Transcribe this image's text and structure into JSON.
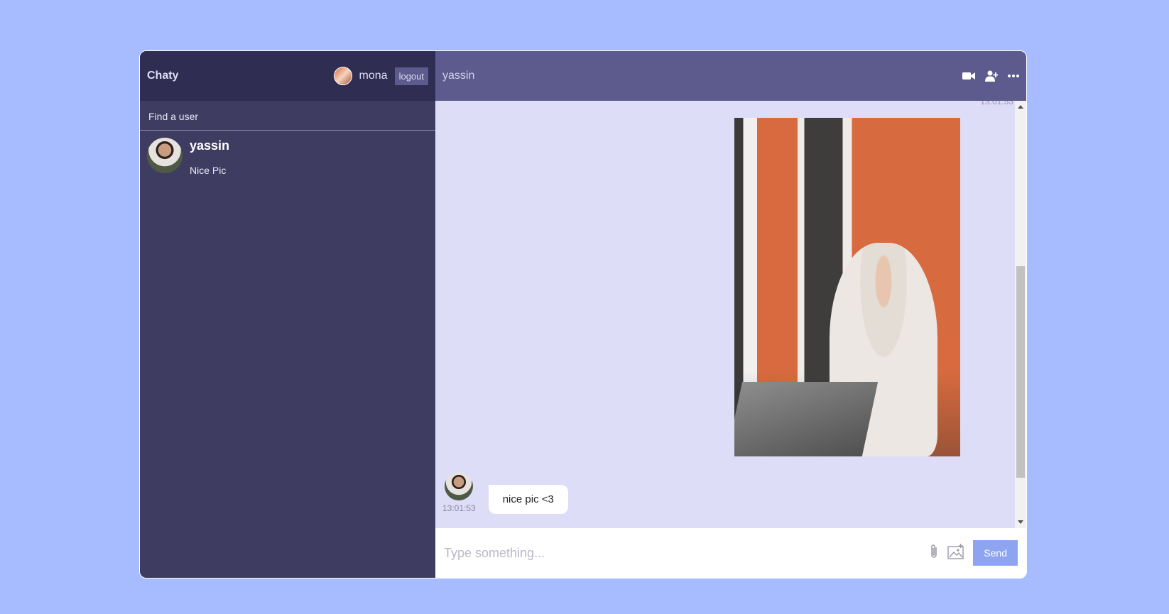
{
  "sidebar": {
    "logo": "Chaty",
    "current_user": {
      "name": "mona"
    },
    "logout_label": "logout",
    "search": {
      "placeholder": "Find a user",
      "value": ""
    },
    "chats": [
      {
        "name": "yassin",
        "last_message": "Nice Pic"
      }
    ]
  },
  "chat": {
    "header": {
      "title": "yassin",
      "icons": [
        "video-camera-icon",
        "add-user-icon",
        "more-icon"
      ]
    },
    "messages": [
      {
        "owner": "self",
        "type": "image",
        "time": "13:01:53"
      },
      {
        "owner": "other",
        "type": "text",
        "text": "nice pic <3",
        "time": "13:01:53"
      }
    ],
    "input": {
      "placeholder": "Type something...",
      "value": "",
      "send_label": "Send"
    }
  },
  "colors": {
    "page_bg": "#a7bcff",
    "sidebar_bg": "#3e3c61",
    "navbar_bg": "#2f2d52",
    "chat_header_bg": "#5d5b8d",
    "messages_bg": "#ddddf7",
    "send_button": "#8da4f1"
  }
}
